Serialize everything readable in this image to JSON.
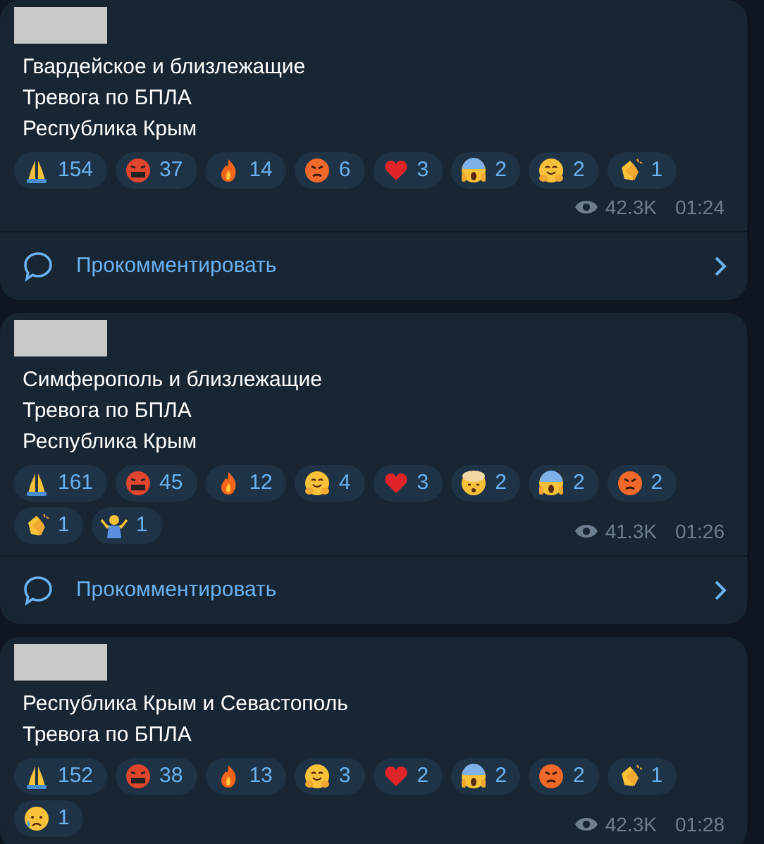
{
  "posts": [
    {
      "lines": [
        "Гвардейское и близлежащие",
        "Тревога по БПЛА",
        "Республика Крым"
      ],
      "reactions": [
        {
          "kind": "pray",
          "count": "154"
        },
        {
          "kind": "cursing",
          "count": "37"
        },
        {
          "kind": "fire",
          "count": "14"
        },
        {
          "kind": "angry",
          "count": "6"
        },
        {
          "kind": "heart",
          "count": "3"
        },
        {
          "kind": "scream",
          "count": "2"
        },
        {
          "kind": "hug",
          "count": "2"
        },
        {
          "kind": "clap",
          "count": "1"
        }
      ],
      "views": "42.3K",
      "time": "01:24",
      "comment_button": "Прокомментировать"
    },
    {
      "lines": [
        "Симферополь и близлежащие",
        "Тревога по БПЛА",
        "Республика Крым"
      ],
      "reactions": [
        {
          "kind": "pray",
          "count": "161"
        },
        {
          "kind": "cursing",
          "count": "45"
        },
        {
          "kind": "fire",
          "count": "12"
        },
        {
          "kind": "hug",
          "count": "4"
        },
        {
          "kind": "heart",
          "count": "3"
        },
        {
          "kind": "exploding",
          "count": "2"
        },
        {
          "kind": "scream",
          "count": "2"
        },
        {
          "kind": "angry",
          "count": "2"
        },
        {
          "kind": "clap",
          "count": "1"
        },
        {
          "kind": "shrug",
          "count": "1"
        }
      ],
      "views": "41.3K",
      "time": "01:26",
      "comment_button": "Прокомментировать"
    },
    {
      "lines": [
        "Республика Крым и Севастополь",
        "Тревога по БПЛА"
      ],
      "reactions": [
        {
          "kind": "pray",
          "count": "152"
        },
        {
          "kind": "cursing",
          "count": "38"
        },
        {
          "kind": "fire",
          "count": "13"
        },
        {
          "kind": "hug",
          "count": "3"
        },
        {
          "kind": "heart",
          "count": "2"
        },
        {
          "kind": "scream",
          "count": "2"
        },
        {
          "kind": "angry",
          "count": "2"
        },
        {
          "kind": "clap",
          "count": "1"
        },
        {
          "kind": "crying",
          "count": "1"
        }
      ],
      "views": "42.3K",
      "time": "01:28"
    }
  ]
}
